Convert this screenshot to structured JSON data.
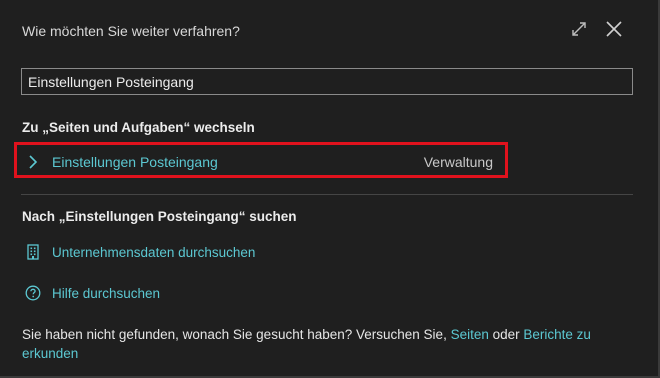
{
  "dialog": {
    "title": "Wie möchten Sie weiter verfahren?",
    "expand_icon": "expand-icon",
    "close_icon": "close-icon"
  },
  "search": {
    "value": "Einstellungen Posteingang"
  },
  "pages_section": {
    "heading": "Zu „Seiten und Aufgaben“ wechseln",
    "results": [
      {
        "label": "Einstellungen Posteingang",
        "category": "Verwaltung",
        "icon": "chevron-right-icon",
        "highlighted": true
      }
    ]
  },
  "search_section": {
    "heading": "Nach „Einstellungen Posteingang“ suchen",
    "actions": [
      {
        "label": "Unternehmensdaten durchsuchen",
        "icon": "building-icon"
      },
      {
        "label": "Hilfe durchsuchen",
        "icon": "help-circle-icon"
      }
    ]
  },
  "footer": {
    "text_before": "Sie haben nicht gefunden, wonach Sie gesucht haben? Versuchen Sie, ",
    "link1": "Seiten",
    "text_middle": " oder ",
    "link2": "Berichte zu erkunden"
  },
  "colors": {
    "background": "#1f1f1f",
    "accent_link": "#5cc8d2",
    "highlight_border": "#e0121d",
    "text": "#e6e6e6"
  }
}
